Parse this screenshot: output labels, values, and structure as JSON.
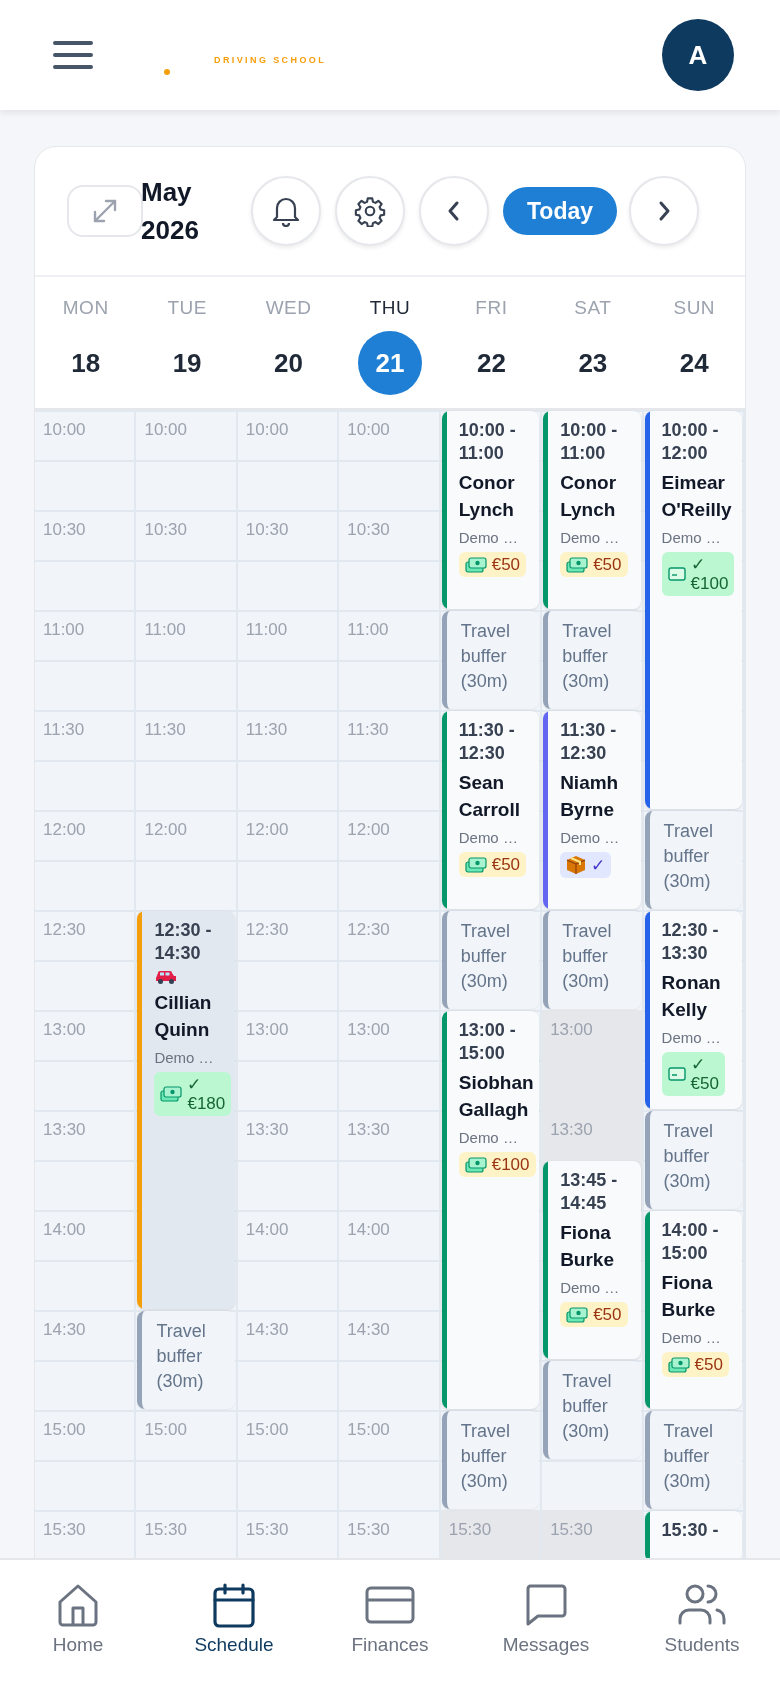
{
  "header": {
    "logo_tagline": "DRIVING SCHOOL",
    "avatar": "A"
  },
  "calendar": {
    "month": "May",
    "year": "2026",
    "today_button": "Today",
    "days": [
      {
        "dow": "MON",
        "date": "18",
        "selected": false,
        "slots": [
          {
            "time": "10:00",
            "blocked": false
          },
          {
            "time": "10:30",
            "blocked": false
          },
          {
            "time": "11:00",
            "blocked": false
          },
          {
            "time": "11:30",
            "blocked": false
          },
          {
            "time": "12:00",
            "blocked": false
          },
          {
            "time": "12:30",
            "blocked": false
          },
          {
            "time": "13:00",
            "blocked": false
          },
          {
            "time": "13:30",
            "blocked": false
          },
          {
            "time": "14:00",
            "blocked": false
          },
          {
            "time": "14:30",
            "blocked": false
          },
          {
            "time": "15:00",
            "blocked": false
          },
          {
            "time": "15:30",
            "blocked": false
          }
        ]
      },
      {
        "dow": "TUE",
        "date": "19",
        "selected": false,
        "slots": [
          {
            "time": "10:00",
            "blocked": false
          },
          {
            "time": "10:30",
            "blocked": false
          },
          {
            "time": "11:00",
            "blocked": false
          },
          {
            "time": "11:30",
            "blocked": false
          },
          {
            "time": "12:00",
            "blocked": false
          },
          {
            "time": "15:00",
            "blocked": false
          },
          {
            "time": "15:30",
            "blocked": false
          }
        ],
        "events": [
          {
            "kind": "lesson",
            "time": "12:30 - 14:30",
            "vehicle": true,
            "name": "Cillian Quinn",
            "note": "Demo …",
            "color": "#f59e0b",
            "payment": {
              "kind": "cash",
              "paid": true,
              "mark": "✓",
              "amount": "€180"
            }
          },
          {
            "kind": "buffer",
            "label": "Travel buffer (30m)"
          }
        ]
      },
      {
        "dow": "WED",
        "date": "20",
        "selected": false,
        "slots": [
          {
            "time": "10:00",
            "blocked": false
          },
          {
            "time": "10:30",
            "blocked": false
          },
          {
            "time": "11:00",
            "blocked": false
          },
          {
            "time": "11:30",
            "blocked": false
          },
          {
            "time": "12:00",
            "blocked": false
          },
          {
            "time": "12:30",
            "blocked": false
          },
          {
            "time": "13:00",
            "blocked": false
          },
          {
            "time": "13:30",
            "blocked": false
          },
          {
            "time": "14:00",
            "blocked": false
          },
          {
            "time": "14:30",
            "blocked": false
          },
          {
            "time": "15:00",
            "blocked": false
          },
          {
            "time": "15:30",
            "blocked": false
          }
        ]
      },
      {
        "dow": "THU",
        "date": "21",
        "selected": true,
        "slots": [
          {
            "time": "10:00",
            "blocked": false
          },
          {
            "time": "10:30",
            "blocked": false
          },
          {
            "time": "11:00",
            "blocked": false
          },
          {
            "time": "11:30",
            "blocked": false
          },
          {
            "time": "12:00",
            "blocked": false
          },
          {
            "time": "12:30",
            "blocked": false
          },
          {
            "time": "13:00",
            "blocked": false
          },
          {
            "time": "13:30",
            "blocked": false
          },
          {
            "time": "14:00",
            "blocked": false
          },
          {
            "time": "14:30",
            "blocked": false
          },
          {
            "time": "15:00",
            "blocked": false
          },
          {
            "time": "15:30",
            "blocked": false
          }
        ]
      },
      {
        "dow": "FRI",
        "date": "22",
        "selected": false,
        "slots": [
          {
            "time": "15:30",
            "blocked": true
          }
        ],
        "events": [
          {
            "kind": "lesson",
            "time": "10:00 - 11:00",
            "name": "Conor Lynch",
            "note": "Demo …",
            "color": "#059669",
            "payment": {
              "kind": "cash",
              "paid": false,
              "amount": "€50"
            }
          },
          {
            "kind": "buffer",
            "label": "Travel buffer (30m)"
          },
          {
            "kind": "lesson",
            "time": "11:30 - 12:30",
            "name": "Sean Carroll",
            "note": "Demo …",
            "color": "#059669",
            "payment": {
              "kind": "cash",
              "paid": false,
              "amount": "€50"
            }
          },
          {
            "kind": "buffer",
            "label": "Travel buffer (30m)"
          },
          {
            "kind": "lesson",
            "time": "13:00 - 15:00",
            "name": "Siobhan Gallagh",
            "note": "Demo …",
            "color": "#059669",
            "payment": {
              "kind": "cash",
              "paid": false,
              "amount": "€100"
            }
          },
          {
            "kind": "buffer",
            "label": "Travel buffer (30m)"
          }
        ]
      },
      {
        "dow": "SAT",
        "date": "23",
        "selected": false,
        "slots": [
          {
            "time": "13:00",
            "blocked": true
          },
          {
            "time": "13:30",
            "blocked": true
          },
          {
            "time": "15:30",
            "blocked": true
          }
        ],
        "events": [
          {
            "kind": "lesson",
            "time": "10:00 - 11:00",
            "name": "Conor Lynch",
            "note": "Demo …",
            "color": "#059669",
            "payment": {
              "kind": "cash",
              "paid": false,
              "amount": "€50"
            }
          },
          {
            "kind": "buffer",
            "label": "Travel buffer (30m)"
          },
          {
            "kind": "lesson",
            "time": "11:30 - 12:30",
            "name": "Niamh Byrne",
            "note": "Demo …",
            "color": "#6366f1",
            "payment": {
              "kind": "package",
              "paid": true,
              "mark": "✓"
            }
          },
          {
            "kind": "buffer",
            "label": "Travel buffer (30m)"
          },
          {
            "kind": "lesson",
            "time": "13:45 - 14:45",
            "name": "Fiona Burke",
            "note": "Demo …",
            "color": "#059669",
            "payment": {
              "kind": "cash",
              "paid": false,
              "amount": "€50"
            }
          },
          {
            "kind": "buffer",
            "label": "Travel buffer (30m)"
          }
        ]
      },
      {
        "dow": "SUN",
        "date": "24",
        "selected": false,
        "events": [
          {
            "kind": "lesson",
            "time": "10:00 - 12:00",
            "name": "Eimear O'Reilly",
            "note": "Demo …",
            "color": "#2563eb",
            "payment": {
              "kind": "card",
              "paid": true,
              "mark": "✓",
              "amount": "€100"
            }
          },
          {
            "kind": "buffer",
            "label": "Travel buffer (30m)"
          },
          {
            "kind": "lesson",
            "time": "12:30 - 13:30",
            "name": "Ronan Kelly",
            "note": "Demo …",
            "color": "#2563eb",
            "payment": {
              "kind": "card",
              "paid": true,
              "mark": "✓",
              "amount": "€50"
            }
          },
          {
            "kind": "buffer",
            "label": "Travel buffer (30m)"
          },
          {
            "kind": "lesson",
            "time": "14:00 - 15:00",
            "name": "Fiona Burke",
            "note": "Demo …",
            "color": "#059669",
            "payment": {
              "kind": "cash",
              "paid": false,
              "amount": "€50"
            }
          },
          {
            "kind": "buffer",
            "label": "Travel buffer (30m)"
          },
          {
            "kind": "lesson",
            "time": "15:30 -",
            "color": "#059669"
          }
        ]
      }
    ]
  },
  "nav": [
    {
      "label": "Home",
      "selected": false
    },
    {
      "label": "Schedule",
      "selected": true
    },
    {
      "label": "Finances",
      "selected": false
    },
    {
      "label": "Messages",
      "selected": false
    },
    {
      "label": "Students",
      "selected": false
    }
  ]
}
